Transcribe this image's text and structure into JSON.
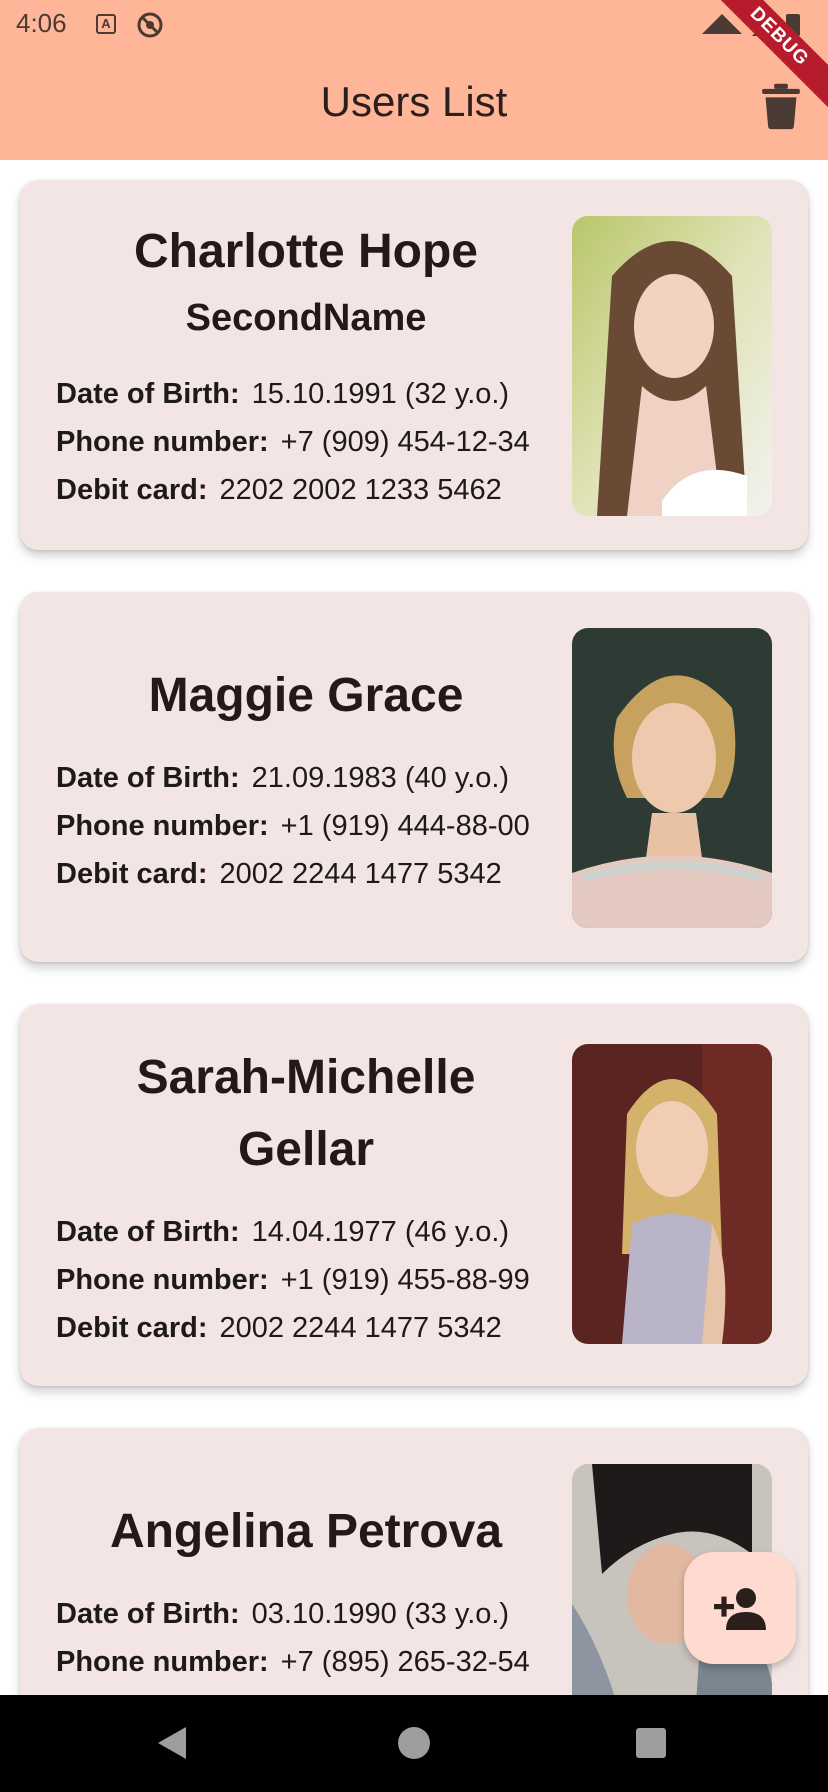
{
  "status_bar": {
    "time": "4:06",
    "notification_icon_a": "A",
    "debug_label": "DEBUG"
  },
  "app_bar": {
    "title": "Users List",
    "action_icon": "trash-icon"
  },
  "users": [
    {
      "first_name": "Charlotte Hope",
      "second_name": "SecondName",
      "dob_label": "Date of Birth:",
      "dob_value": "15.10.1991 (32 y.o.)",
      "phone_label": "Phone number:",
      "phone_value": "+7 (909) 454-12-34",
      "card_label": "Debit card:",
      "card_value": "2202 2002 1233 5462"
    },
    {
      "first_name": "Maggie Grace",
      "dob_label": "Date of Birth:",
      "dob_value": "21.09.1983 (40 y.o.)",
      "phone_label": "Phone number:",
      "phone_value": "+1 (919) 444-88-00",
      "card_label": "Debit card:",
      "card_value": "2002 2244 1477 5342"
    },
    {
      "first_name_line1": "Sarah-Michelle",
      "first_name_line2": "Gellar",
      "dob_label": "Date of Birth:",
      "dob_value": "14.04.1977 (46 y.o.)",
      "phone_label": "Phone number:",
      "phone_value": "+1 (919) 455-88-99",
      "card_label": "Debit card:",
      "card_value": "2002 2244 1477 5342"
    },
    {
      "first_name": "Angelina Petrova",
      "dob_label": "Date of Birth:",
      "dob_value": "03.10.1990 (33 y.o.)",
      "phone_label": "Phone number:",
      "phone_value": "+7 (895) 265-32-54"
    }
  ],
  "fab": {
    "icon": "add-person-icon"
  },
  "colors": {
    "app_bar": "#ffb598",
    "card": "#f2e5e3",
    "fab": "#ffdad1",
    "debug": "#b71c2c"
  }
}
